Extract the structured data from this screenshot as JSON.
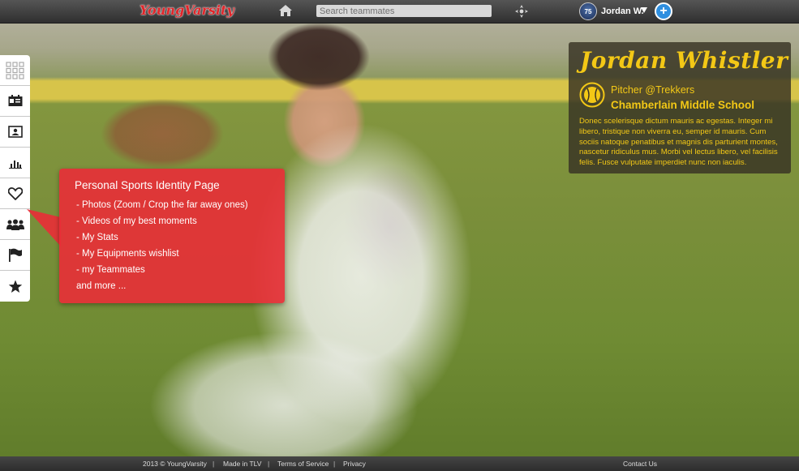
{
  "app": {
    "logo_text": "YoungVarsity"
  },
  "topbar": {
    "search_placeholder": "Search teammates",
    "user_name": "Jordan W.",
    "avatar_label": "75",
    "icons": [
      "home-icon",
      "navigation-icon",
      "caret-down-icon",
      "plus-icon"
    ]
  },
  "sidebar": {
    "items": [
      {
        "name": "grid",
        "icon": "grid-icon"
      },
      {
        "name": "profile-card",
        "icon": "id-card-icon"
      },
      {
        "name": "photos",
        "icon": "photo-frame-icon"
      },
      {
        "name": "stats",
        "icon": "bar-chart-icon"
      },
      {
        "name": "wishlist",
        "icon": "heart-icon"
      },
      {
        "name": "teammates",
        "icon": "team-icon"
      },
      {
        "name": "achievements",
        "icon": "flag-icon"
      },
      {
        "name": "favorites",
        "icon": "star-icon"
      }
    ]
  },
  "callout": {
    "title": "Personal Sports Identity Page",
    "items": [
      "- Photos (Zoom / Crop the far away ones)",
      "- Videos of my best moments",
      "- My Stats",
      "- My Equipments wishlist",
      "- my Teammates",
      "and more ..."
    ],
    "color": "#e92d37"
  },
  "profile": {
    "name": "Jordan Whistler",
    "position": "Pitcher @Trekkers",
    "school": "Chamberlain Middle School",
    "bio": "Donec scelerisque dictum mauris ac egestas. Integer mi libero, tristique non viverra eu, semper id mauris. Cum sociis natoque penatibus et magnis dis parturient montes, nascetur ridiculus mus. Morbi vel lectus libero, vel facilisis felis. Fusce vulputate imperdiet nunc non iaculis.",
    "accent_color": "#f3c816"
  },
  "footer": {
    "copyright": "2013 © YoungVarsity",
    "made_in": "Made in TLV",
    "terms": "Terms of Service",
    "privacy": "Privacy",
    "contact": "Contact Us",
    "separator": "|"
  }
}
